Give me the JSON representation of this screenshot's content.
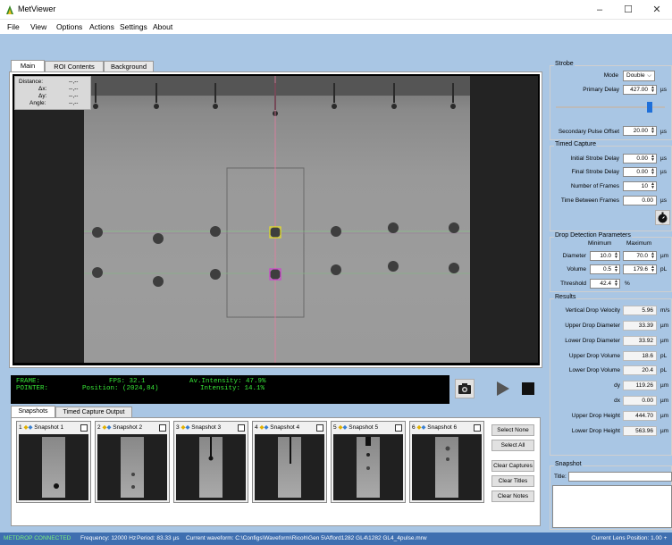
{
  "window": {
    "title": "MetViewer",
    "minimize": "–",
    "maximize": "☐",
    "close": "✕"
  },
  "menu": [
    "File",
    "View",
    "Options",
    "Actions",
    "Settings",
    "About"
  ],
  "viewer_tabs": [
    "Main",
    "ROI Contents",
    "Background"
  ],
  "measure": {
    "distance_label": "Distance:",
    "distance_value": "--,--",
    "dx_label": "Δx:",
    "dx_value": "--,--",
    "dy_label": "Δy:",
    "dy_value": "--,--",
    "angle_label": "Angle:",
    "angle_value": "--,--"
  },
  "console": {
    "frame_label": "FRAME:",
    "pointer_label": "POINTER:",
    "fps": "FPS: 32.1",
    "position": "Position: (2024,84)",
    "av_intensity": "Av.Intensity: 47.9%",
    "intensity": "Intensity: 14.1%"
  },
  "snapshot_tabs": [
    "Snapshots",
    "Timed Capture Output"
  ],
  "snapshots": [
    {
      "num": "1",
      "title": "Snapshot 1"
    },
    {
      "num": "2",
      "title": "Snapshot 2"
    },
    {
      "num": "3",
      "title": "Snapshot 3"
    },
    {
      "num": "4",
      "title": "Snapshot 4"
    },
    {
      "num": "5",
      "title": "Snapshot 5"
    },
    {
      "num": "6",
      "title": "Snapshot 6"
    }
  ],
  "snapshot_buttons": {
    "select_none": "Select None",
    "select_all": "Select All",
    "clear_captures": "Clear Captures",
    "clear_titles": "Clear Titles",
    "clear_notes": "Clear Notes"
  },
  "strobe": {
    "group": "Strobe",
    "mode_label": "Mode",
    "mode_value": "Double",
    "primary_delay_label": "Primary Delay",
    "primary_delay_value": "427.00",
    "primary_delay_unit": "µs",
    "primary_delay_slider": 0.86,
    "secondary_label": "Secondary Pulse Offset",
    "secondary_value": "20.00",
    "secondary_unit": "µs"
  },
  "timed_capture": {
    "group": "Timed Capture",
    "initial_label": "Initial Strobe Delay",
    "initial_value": "0.00",
    "initial_unit": "µs",
    "final_label": "Final Strobe Delay",
    "final_value": "0.00",
    "final_unit": "µs",
    "frames_label": "Number of Frames",
    "frames_value": "10",
    "between_label": "Time Between Frames",
    "between_value": "0.00",
    "between_unit": "µs"
  },
  "drop_detection": {
    "group": "Drop Detection Parameters",
    "min_header": "Minimum",
    "max_header": "Maximum",
    "diameter_label": "Diameter",
    "diameter_min": "10.0",
    "diameter_max": "70.0",
    "diameter_unit": "µm",
    "volume_label": "Volume",
    "volume_min": "0.5",
    "volume_max": "179.6",
    "volume_unit": "pL",
    "threshold_label": "Threshold",
    "threshold_value": "42.4",
    "threshold_unit": "%"
  },
  "results": {
    "group": "Results",
    "rows": [
      {
        "label": "Vertical Drop Velocity",
        "value": "5.96",
        "unit": "m/s"
      },
      {
        "label": "Upper Drop Diameter",
        "value": "33.39",
        "unit": "µm"
      },
      {
        "label": "Lower Drop Diameter",
        "value": "33.92",
        "unit": "µm"
      },
      {
        "label": "Upper Drop Volume",
        "value": "18.6",
        "unit": "pL"
      },
      {
        "label": "Lower Drop Volume",
        "value": "20.4",
        "unit": "pL"
      },
      {
        "label": "dy",
        "value": "119.26",
        "unit": "µm"
      },
      {
        "label": "dx",
        "value": "0.00",
        "unit": "µm"
      },
      {
        "label": "Upper Drop Height",
        "value": "444.70",
        "unit": "µm"
      },
      {
        "label": "Lower Drop Height",
        "value": "563.96",
        "unit": "µm"
      }
    ]
  },
  "snapshot_panel": {
    "group": "Snapshot",
    "title_label": "Title:"
  },
  "status": {
    "connected": "METDROP CONNECTED",
    "frequency": "Frequency: 12000 Hz",
    "period": "Period: 83.33 µs",
    "waveform": "Current waveform: C:\\Configs\\Waveform\\Ricoh\\Gen 5\\Afford1282 GL4\\1282 GL4_4pulse.mrw",
    "lens": "Current Lens Position: 1.00 +"
  },
  "colors": {
    "app_bg": "#a9c6e4",
    "status_bg": "#3f6fb0",
    "console_text": "#38e838",
    "connected": "#7cf07c"
  }
}
